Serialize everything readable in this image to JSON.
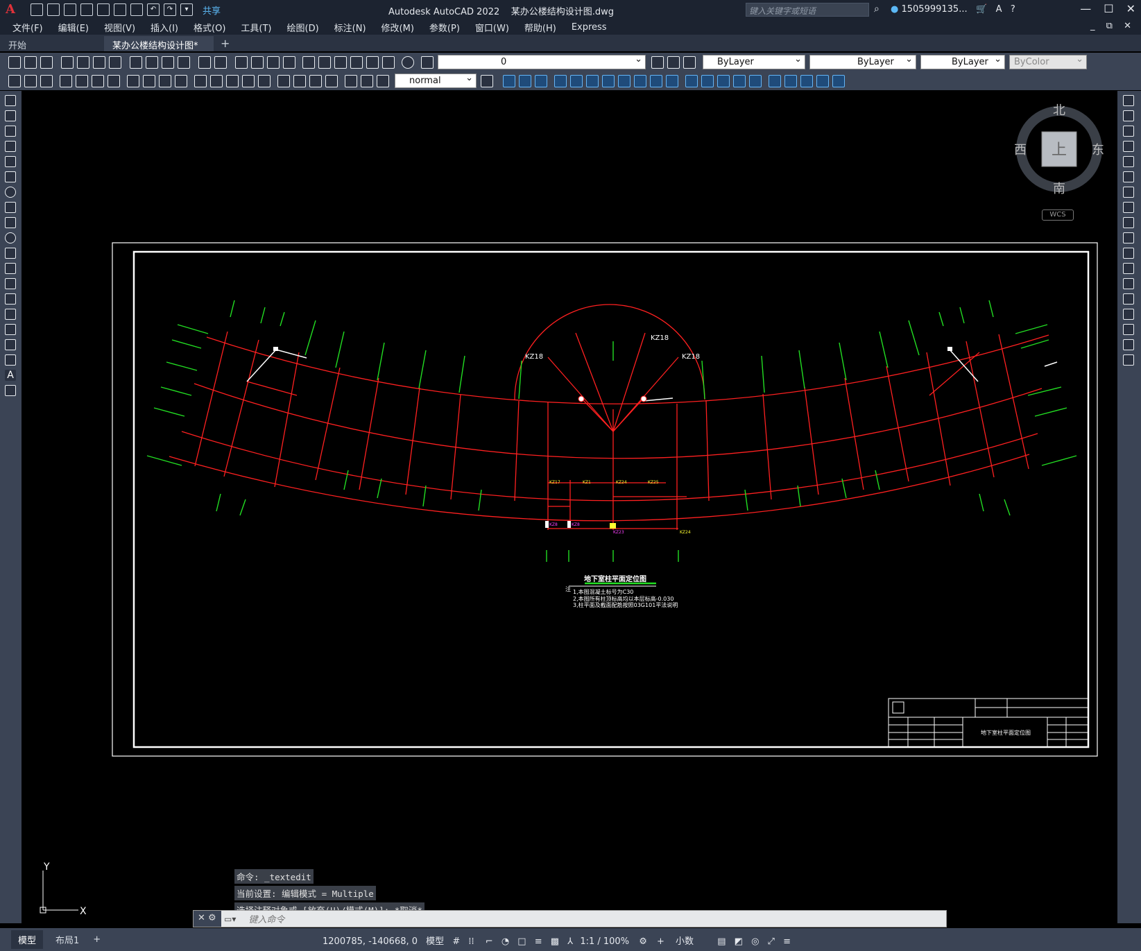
{
  "title_bar": {
    "app_title": "Autodesk AutoCAD 2022",
    "doc_title": "某办公楼结构设计图.dwg",
    "share_label": "共享",
    "search_placeholder": "键入关键字或短语",
    "user_name": "1505999135...",
    "window_controls": [
      "—",
      "☐",
      "✕"
    ]
  },
  "menu": {
    "items": [
      "文件(F)",
      "编辑(E)",
      "视图(V)",
      "插入(I)",
      "格式(O)",
      "工具(T)",
      "绘图(D)",
      "标注(N)",
      "修改(M)",
      "参数(P)",
      "窗口(W)",
      "帮助(H)",
      "Express"
    ],
    "doc_controls": "_ ⧉ ✕"
  },
  "tabs": {
    "start": "开始",
    "active_doc": "某办公楼结构设计图*",
    "add": "+"
  },
  "properties": {
    "layer_value": "0",
    "color": "ByLayer",
    "linetype": "ByLayer",
    "lineweight": "ByLayer",
    "plotstyle": "ByColor",
    "text_style": "normal"
  },
  "viewcube": {
    "north": "北",
    "south": "南",
    "east": "东",
    "west": "西",
    "top": "上",
    "wcs": "WCS"
  },
  "drawing": {
    "labels": {
      "kz18_left": "KZ18",
      "kz18_top": "KZ18",
      "kz18_right": "KZ18",
      "kz17": "KZ17",
      "kz1": "KZ1",
      "kz24": "KZ24",
      "kz25": "KZ25",
      "kz23": "KZ23",
      "kz24b": "KZ24",
      "kz8a": "KZ8",
      "kz8b": "KZ8"
    },
    "plan_title": "地下室柱平面定位图",
    "note_prefix": "注",
    "notes": [
      "1,本图混凝土标号为C30",
      "2,本图所有柱顶标高均以本层标高-0.030",
      "3,柱平面及截面配筋按照03G101平法说明"
    ],
    "titleblock_name": "地下室柱平面定位图"
  },
  "command": {
    "history": [
      "命令: _textedit",
      "当前设置: 编辑模式 = Multiple",
      "选择注释对象或 [放弃(U)/模式(M)]: *取消*"
    ],
    "placeholder": "键入命令"
  },
  "status": {
    "model_tab": "模型",
    "layout_tab": "布局1",
    "add": "+",
    "coords": "1200785, -140668, 0",
    "space": "模型",
    "scale": "1:1 / 100%",
    "units": "小数"
  },
  "ucs": {
    "x": "X",
    "y": "Y"
  },
  "colors": {
    "grid_red": "#ff2020",
    "axis_green": "#22dd22",
    "label_white": "#ffffff",
    "label_yellow": "#ffff30",
    "ui_dark": "#1c2330",
    "ui_panel": "#3b4455",
    "accent_blue": "#5cb8f5"
  }
}
